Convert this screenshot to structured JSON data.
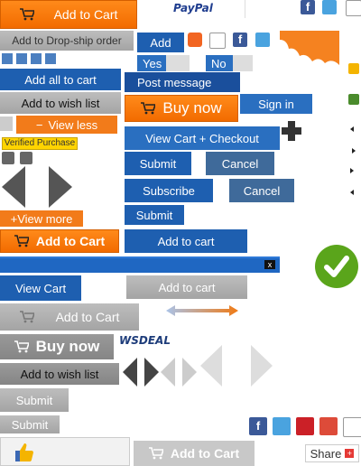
{
  "buttons": {
    "add_to_cart_1": "Add to Cart",
    "paypal": "PayPal",
    "add_dropship": "Add to Drop-ship order",
    "add": "Add",
    "yes": "Yes",
    "no": "No",
    "add_all_cart": "Add all to cart",
    "post_message": "Post message",
    "add_wishlist_1": "Add to wish list",
    "buy_now_1": "Buy now",
    "sign_in": "Sign in",
    "view_less": "View less",
    "verified": "Verified Purchase",
    "view_cart_checkout": "View Cart + Checkout",
    "submit_1": "Submit",
    "cancel_1": "Cancel",
    "subscribe": "Subscribe",
    "cancel_2": "Cancel",
    "submit_2": "Submit",
    "view_more": "+View more",
    "add_to_cart_2": "Add to Cart",
    "add_to_cart_small": "Add to cart",
    "view_cart": "View Cart",
    "add_to_cart_gray": "Add to cart",
    "add_to_cart_3": "Add to Cart",
    "buy_now_2": "Buy now",
    "wsdeal": "WSDEAL",
    "add_wishlist_2": "Add to wish list",
    "submit_3": "Submit",
    "submit_4": "Submit",
    "add_to_cart_4": "Add to Cart",
    "share": "Share",
    "close_x": "x"
  },
  "colors": {
    "orange": "#f27b1a",
    "blue": "#1e5fb0",
    "gray": "#b0b0b0",
    "green_check": "#5aa51b",
    "verified_yellow": "#ffd400"
  }
}
